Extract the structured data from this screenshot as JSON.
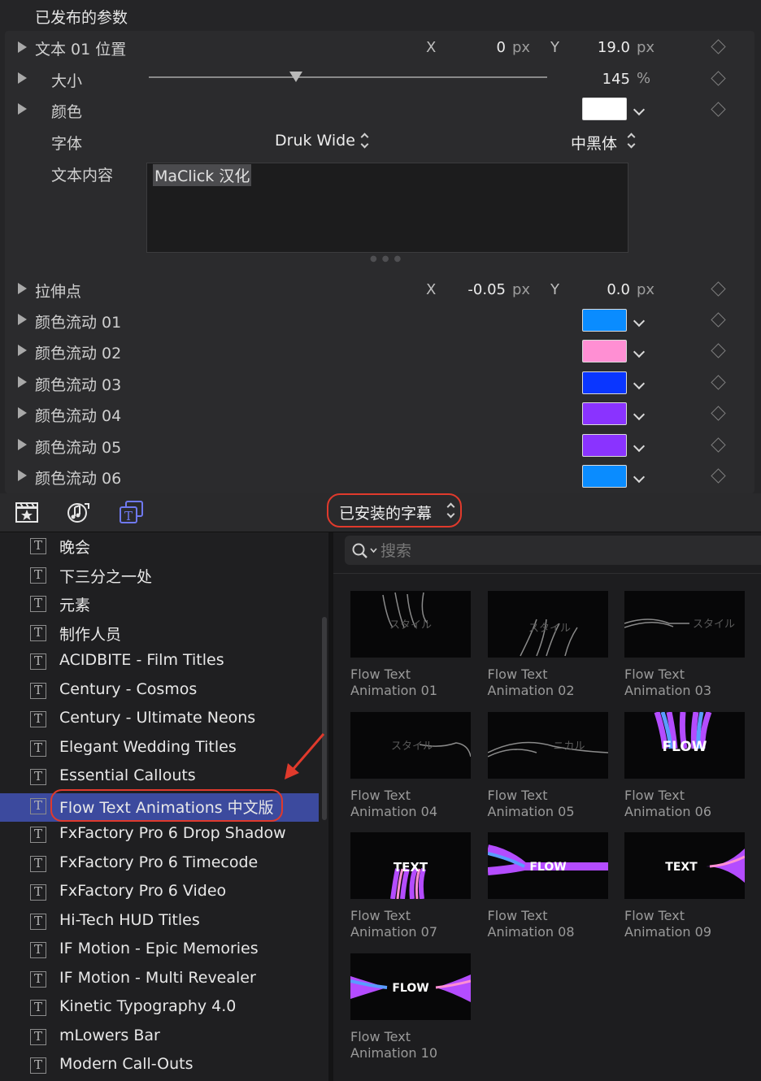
{
  "inspector": {
    "header": "已发布的参数",
    "position": {
      "label": "文本 01 位置",
      "x_label": "X",
      "x_value": "0",
      "x_unit": "px",
      "y_label": "Y",
      "y_value": "19.0",
      "y_unit": "px"
    },
    "size": {
      "label": "大小",
      "value": "145",
      "unit": "%",
      "slider_fraction": 0.37
    },
    "color": {
      "label": "颜色",
      "value": "#ffffff"
    },
    "font": {
      "label": "字体",
      "family": "Druk Wide",
      "style": "中黑体"
    },
    "text_content": {
      "label": "文本内容",
      "value": "MaClick 汉化"
    },
    "anchor": {
      "label": "拉伸点",
      "x_label": "X",
      "x_value": "-0.05",
      "x_unit": "px",
      "y_label": "Y",
      "y_value": "0.0",
      "y_unit": "px"
    },
    "color_flows": [
      {
        "label": "颜色流动 01",
        "color": "#0a8cff"
      },
      {
        "label": "颜色流动 02",
        "color": "#ff8fd3"
      },
      {
        "label": "颜色流动 03",
        "color": "#0a36ff"
      },
      {
        "label": "颜色流动 04",
        "color": "#8a33ff"
      },
      {
        "label": "颜色流动 05",
        "color": "#8a33ff"
      },
      {
        "label": "颜色流动 06",
        "color": "#0a8cff"
      }
    ]
  },
  "toolbar": {
    "icons": [
      "clapper-star-icon",
      "music-notes-icon",
      "titles-icon"
    ],
    "category_selector": "已安装的字幕"
  },
  "sidebar": {
    "items": [
      "晚会",
      "下三分之一处",
      "元素",
      "制作人员",
      "ACIDBITE - Film Titles",
      "Century - Cosmos",
      "Century - Ultimate Neons",
      "Elegant Wedding Titles",
      "Essential Callouts",
      "Flow Text Animations 中文版",
      "FxFactory Pro 6 Drop Shadow",
      "FxFactory Pro 6 Timecode",
      "FxFactory Pro 6 Video",
      "Hi-Tech HUD Titles",
      "IF Motion - Epic Memories",
      "IF Motion - Multi Revealer",
      "Kinetic Typography 4.0",
      "mLowers Bar",
      "Modern Call-Outs"
    ],
    "selected_index": 9,
    "icon_glyph": "T"
  },
  "browser": {
    "search_placeholder": "搜索",
    "thumbnails": [
      {
        "line1": "Flow Text",
        "line2": "Animation 01",
        "art": "スタイル"
      },
      {
        "line1": "Flow Text",
        "line2": "Animation 02",
        "art": "スタイル"
      },
      {
        "line1": "Flow Text",
        "line2": "Animation 03",
        "art": "スタイル"
      },
      {
        "line1": "Flow Text",
        "line2": "Animation 04",
        "art": "スタイル"
      },
      {
        "line1": "Flow Text",
        "line2": "Animation 05",
        "art": "ニカル"
      },
      {
        "line1": "Flow Text",
        "line2": "Animation 06",
        "art": "FLOW"
      },
      {
        "line1": "Flow Text",
        "line2": "Animation 07",
        "art": "TEXT"
      },
      {
        "line1": "Flow Text",
        "line2": "Animation 08",
        "art": "FLOW"
      },
      {
        "line1": "Flow Text",
        "line2": "Animation 09",
        "art": "TEXT"
      },
      {
        "line1": "Flow Text",
        "line2": "Animation 10",
        "art": "FLOW"
      }
    ]
  }
}
